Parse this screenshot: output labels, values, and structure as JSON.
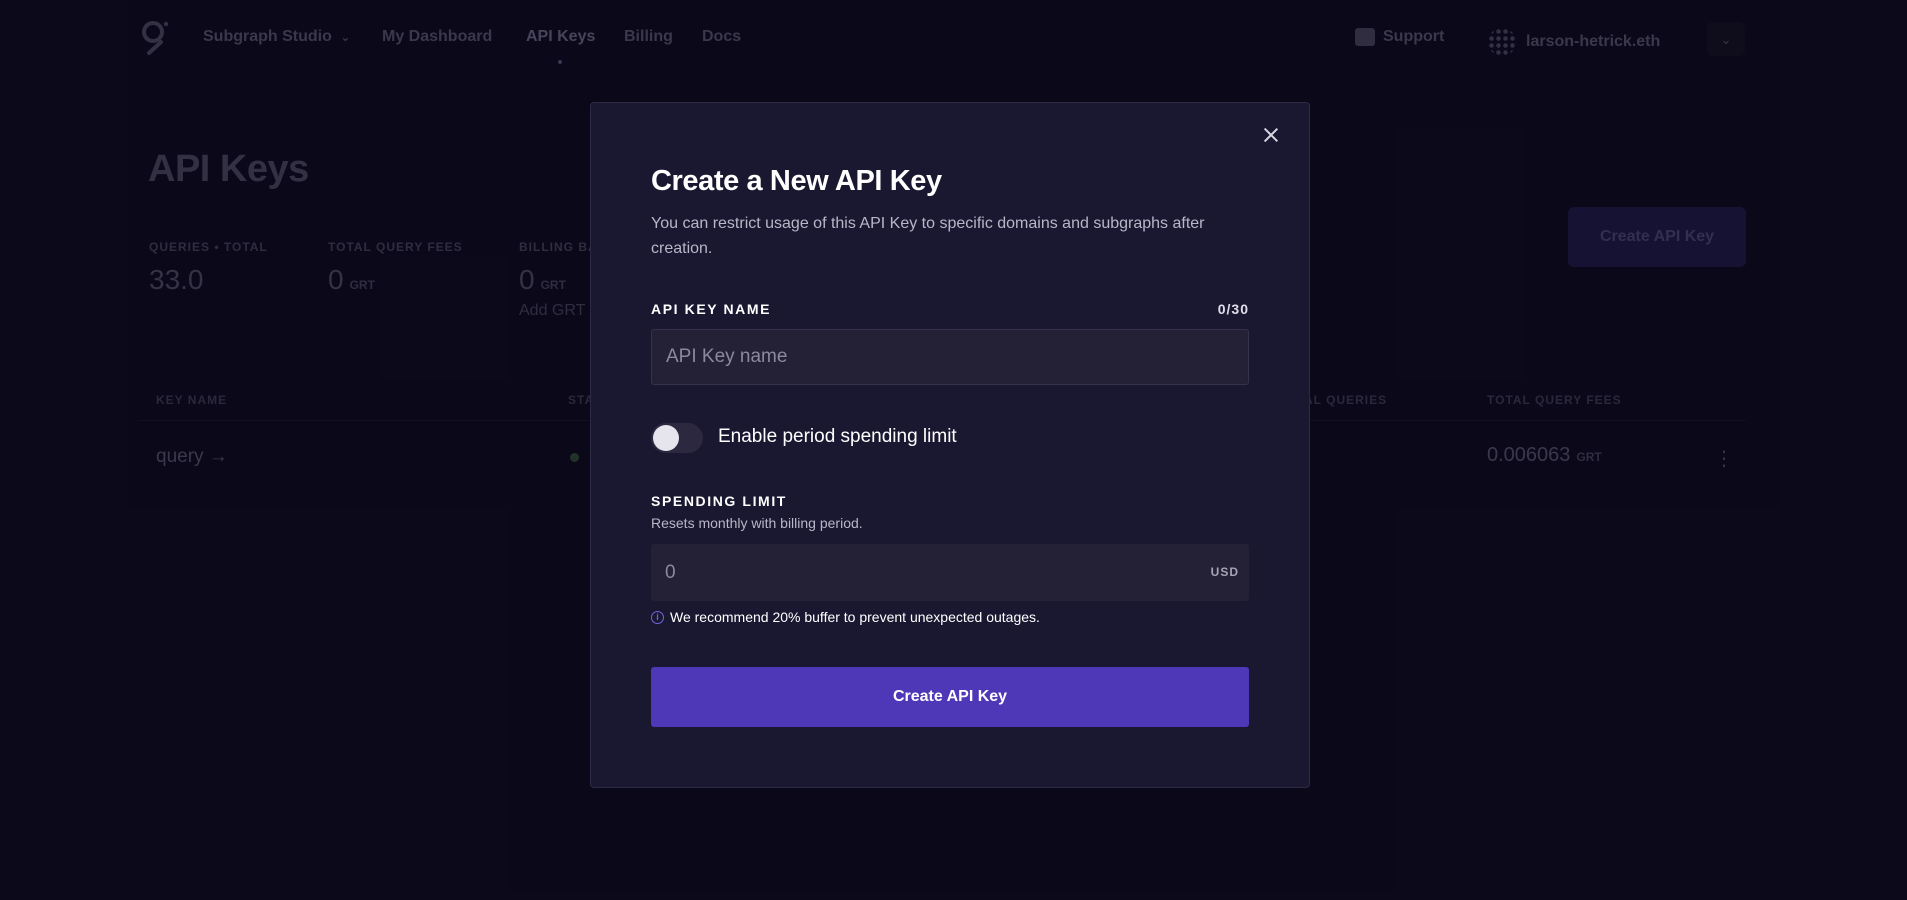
{
  "nav": {
    "product": "Subgraph Studio",
    "links": [
      "My Dashboard",
      "API Keys",
      "Billing",
      "Docs"
    ],
    "support": "Support",
    "user": "larson-hetrick.eth"
  },
  "page": {
    "title": "API Keys",
    "create_button": "Create API Key",
    "stats": {
      "queries_label": "QUERIES • TOTAL",
      "queries_value": "33.0",
      "fees_label": "TOTAL QUERY FEES",
      "fees_value": "0",
      "fees_unit": "GRT",
      "billing_label": "BILLING BA",
      "billing_value": "0",
      "billing_unit": "GRT",
      "billing_link": "Add GRT"
    },
    "table": {
      "headers": [
        "KEY NAME",
        "STA",
        "AL QUERIES",
        "TOTAL QUERY FEES"
      ],
      "rows": [
        {
          "name": "query →",
          "fees": "0.006063",
          "fees_unit": "GRT"
        }
      ]
    }
  },
  "modal": {
    "title": "Create a New API Key",
    "subtitle": "You can restrict usage of this API Key to specific domains and subgraphs after creation.",
    "name_label": "API KEY NAME",
    "name_counter": "0/30",
    "name_placeholder": "API Key name",
    "name_value": "",
    "toggle_label": "Enable period spending limit",
    "toggle_on": false,
    "limit_label": "SPENDING LIMIT",
    "limit_hint": "Resets monthly with billing period.",
    "limit_placeholder": "0",
    "limit_unit": "USD",
    "info_text": "We recommend 20% buffer to prevent unexpected outages.",
    "submit_label": "Create API Key"
  },
  "colors": {
    "background": "#0c0a1d",
    "modal": "#1a1731",
    "accent": "#4f38b8",
    "info": "#6f67e0"
  }
}
